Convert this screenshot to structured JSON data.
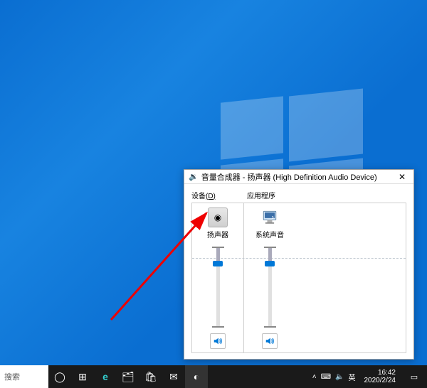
{
  "mixer": {
    "title": "音量合成器 - 扬声器 (High Definition Audio Device)",
    "sectionDevice": "设备",
    "deviceAccel": "(D)",
    "sectionApps": "应用程序",
    "device": {
      "label": "扬声器",
      "level": 80
    },
    "apps": [
      {
        "label": "系统声音",
        "level": 80
      }
    ]
  },
  "taskbar": {
    "search": "搜索",
    "ime": "英",
    "time": "16:42",
    "date": "2020/2/24"
  }
}
